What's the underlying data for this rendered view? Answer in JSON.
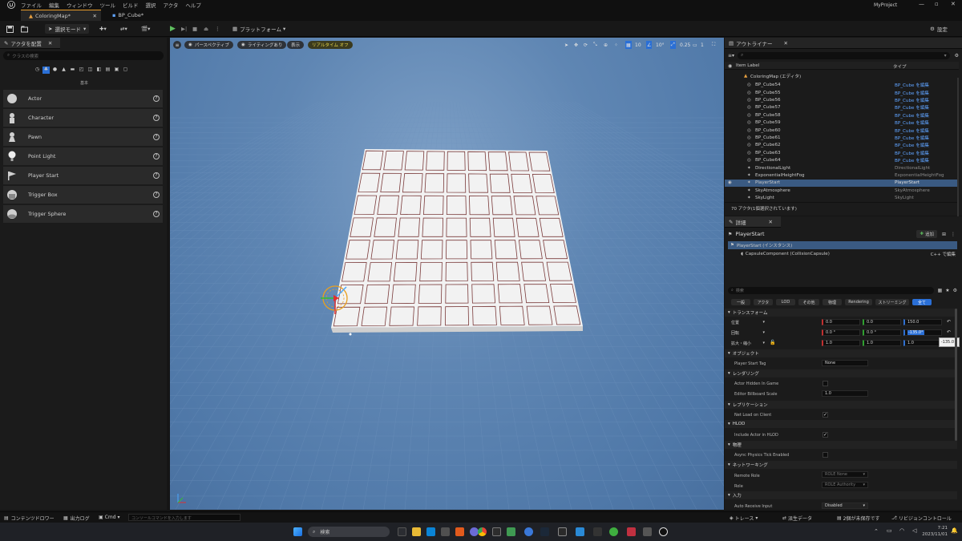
{
  "menubar": {
    "items": [
      "ファイル",
      "編集",
      "ウィンドウ",
      "ツール",
      "ビルド",
      "選択",
      "アクタ",
      "ヘルプ"
    ],
    "project": "MyProject"
  },
  "tabs": [
    {
      "label": "ColoringMap*"
    },
    {
      "label": "BP_Cube*"
    }
  ],
  "toolbar": {
    "mode_label": "選択モード",
    "platform_label": "プラットフォーム",
    "settings_label": "設定"
  },
  "place_actors": {
    "tab_label": "アクタを配置",
    "search_placeholder": "クラスの検索",
    "category": "基本",
    "items": [
      {
        "label": "Actor"
      },
      {
        "label": "Character"
      },
      {
        "label": "Pawn"
      },
      {
        "label": "Point Light"
      },
      {
        "label": "Player Start"
      },
      {
        "label": "Trigger Box"
      },
      {
        "label": "Trigger Sphere"
      }
    ]
  },
  "viewport": {
    "perspective_label": "パースペクティブ",
    "lighting_label": "ライティングあり",
    "show_label": "表示",
    "realtime_label": "リアルタイム オフ",
    "grid_snap": "10",
    "rotation_snap": "10°",
    "scale_snap": "0.25",
    "camera_speed": "1",
    "grid": {
      "rows": 8,
      "cols": 9
    }
  },
  "outliner": {
    "tab_label": "アウトライナー",
    "col_label": "Item Label",
    "col_type": "タイプ",
    "root": "ColoringMap (エディタ)",
    "rows": [
      {
        "name": "BP_Cube54",
        "type": "BP_Cube を編集"
      },
      {
        "name": "BP_Cube55",
        "type": "BP_Cube を編集"
      },
      {
        "name": "BP_Cube56",
        "type": "BP_Cube を編集"
      },
      {
        "name": "BP_Cube57",
        "type": "BP_Cube を編集"
      },
      {
        "name": "BP_Cube58",
        "type": "BP_Cube を編集"
      },
      {
        "name": "BP_Cube59",
        "type": "BP_Cube を編集"
      },
      {
        "name": "BP_Cube60",
        "type": "BP_Cube を編集"
      },
      {
        "name": "BP_Cube61",
        "type": "BP_Cube を編集"
      },
      {
        "name": "BP_Cube62",
        "type": "BP_Cube を編集"
      },
      {
        "name": "BP_Cube63",
        "type": "BP_Cube を編集"
      },
      {
        "name": "BP_Cube64",
        "type": "BP_Cube を編集"
      },
      {
        "name": "DirectionalLight",
        "type": "DirectionalLight"
      },
      {
        "name": "ExponentialHeightFog",
        "type": "ExponentialHeightFog"
      },
      {
        "name": "PlayerStart",
        "type": "PlayerStart",
        "selected": true
      },
      {
        "name": "SkyAtmosphere",
        "type": "SkyAtmosphere"
      },
      {
        "name": "SkyLight",
        "type": "SkyLight"
      }
    ],
    "count_label": "70 アクタ(1個選択されています)"
  },
  "details": {
    "tab_label": "詳細",
    "actor_name": "PlayerStart",
    "add_label": "追加",
    "instance_label": "PlayerStart (インスタンス)",
    "component_label": "CapsuleComponent (CollisionCapsule)",
    "cpp_edit_label": "C++ で編集",
    "search_placeholder": "検索",
    "filters": [
      "一般",
      "アクタ",
      "LOD",
      "その他",
      "物理",
      "Rendering",
      "ストリーミング",
      "全て"
    ],
    "transform": {
      "title": "トランスフォーム",
      "location_label": "位置",
      "rotation_label": "回転",
      "scale_label": "拡大・縮小",
      "location": [
        "0.0",
        "0.0",
        "150.0"
      ],
      "rotation": [
        "0.0 °",
        "0.0 °",
        "-135.0°"
      ],
      "scale": [
        "1.0",
        "1.0",
        "1.0"
      ],
      "tooltip": "-135.0 °"
    },
    "sections": {
      "object": "オブジェクト",
      "player_start_tag": "Player Start Tag",
      "player_start_tag_value": "None",
      "rendering": "レンダリング",
      "actor_hidden": "Actor Hidden In Game",
      "billboard_scale": "Editor Billboard Scale",
      "billboard_scale_value": "1.0",
      "replication": "レプリケーション",
      "net_load": "Net Load on Client",
      "hlod": "HLOD",
      "include_hlod": "Include Actor in HLOD",
      "physics": "物理",
      "async_physics": "Async Physics Tick Enabled",
      "networking": "ネットワーキング",
      "remote_role": "Remote Role",
      "remote_role_value": "ROLE None",
      "role": "Role",
      "role_value": "ROLE Authority",
      "input": "入力",
      "auto_receive": "Auto Receive Input",
      "auto_receive_value": "Disabled"
    }
  },
  "statusbar": {
    "content_drawer": "コンテンツドロワー",
    "output_log": "出力ログ",
    "cmd": "Cmd",
    "console_placeholder": "コンソールコマンドを入力します",
    "trace": "トレース",
    "derived_data": "派生データ",
    "unsaved": "2個が未保存です",
    "revision_control": "リビジョンコントロール"
  },
  "taskbar": {
    "search_label": "検索",
    "time": "7:21",
    "date": "2023/11/01"
  }
}
